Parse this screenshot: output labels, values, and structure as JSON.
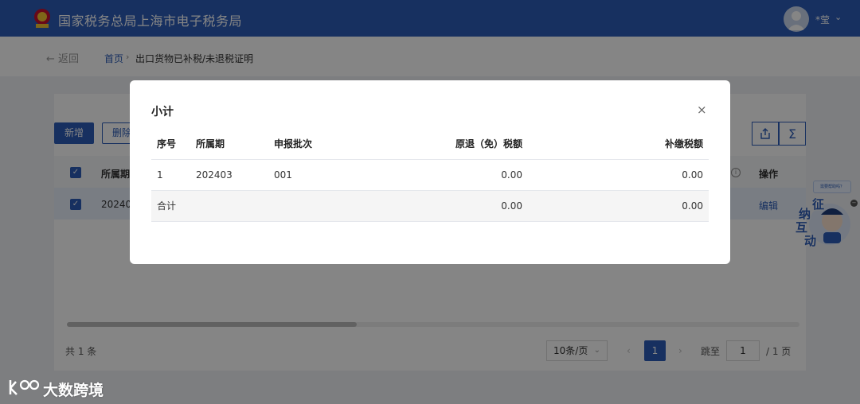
{
  "header": {
    "title": "国家税务总局上海市电子税务局",
    "user_name": "*莹",
    "accent": "#2c5db8"
  },
  "breadcrumb": {
    "back_label": "返回",
    "home_label": "首页",
    "separator": "›",
    "current_label": "出口货物已补税/未退税证明"
  },
  "toolbar": {
    "add_label": "新增",
    "delete_label": "删除",
    "export_icon": "export-icon",
    "sum_icon": "sigma-icon"
  },
  "grid": {
    "columns": [
      "所属期",
      "操作"
    ],
    "rows": [
      {
        "period": "20240",
        "action": "编辑"
      }
    ]
  },
  "pagination": {
    "total": "共 1 条",
    "page_size": "10条/页",
    "current_page": "1",
    "jump_label": "跳至",
    "jump_value": "1",
    "total_pages": "/ 1 页"
  },
  "assistant": {
    "bubble": "需要帮助吗？",
    "chars": [
      "征",
      "纳",
      "互",
      "动"
    ]
  },
  "watermark": {
    "text": "大数跨境"
  },
  "modal": {
    "title": "小计",
    "close": "×",
    "columns": [
      "序号",
      "所属期",
      "申报批次",
      "原退（免）税额",
      "补缴税额"
    ],
    "rows": [
      [
        "1",
        "202403",
        "001",
        "0.00",
        "0.00"
      ]
    ],
    "summary": {
      "label": "合计",
      "original_refund": "0.00",
      "supplementary_tax": "0.00"
    }
  }
}
